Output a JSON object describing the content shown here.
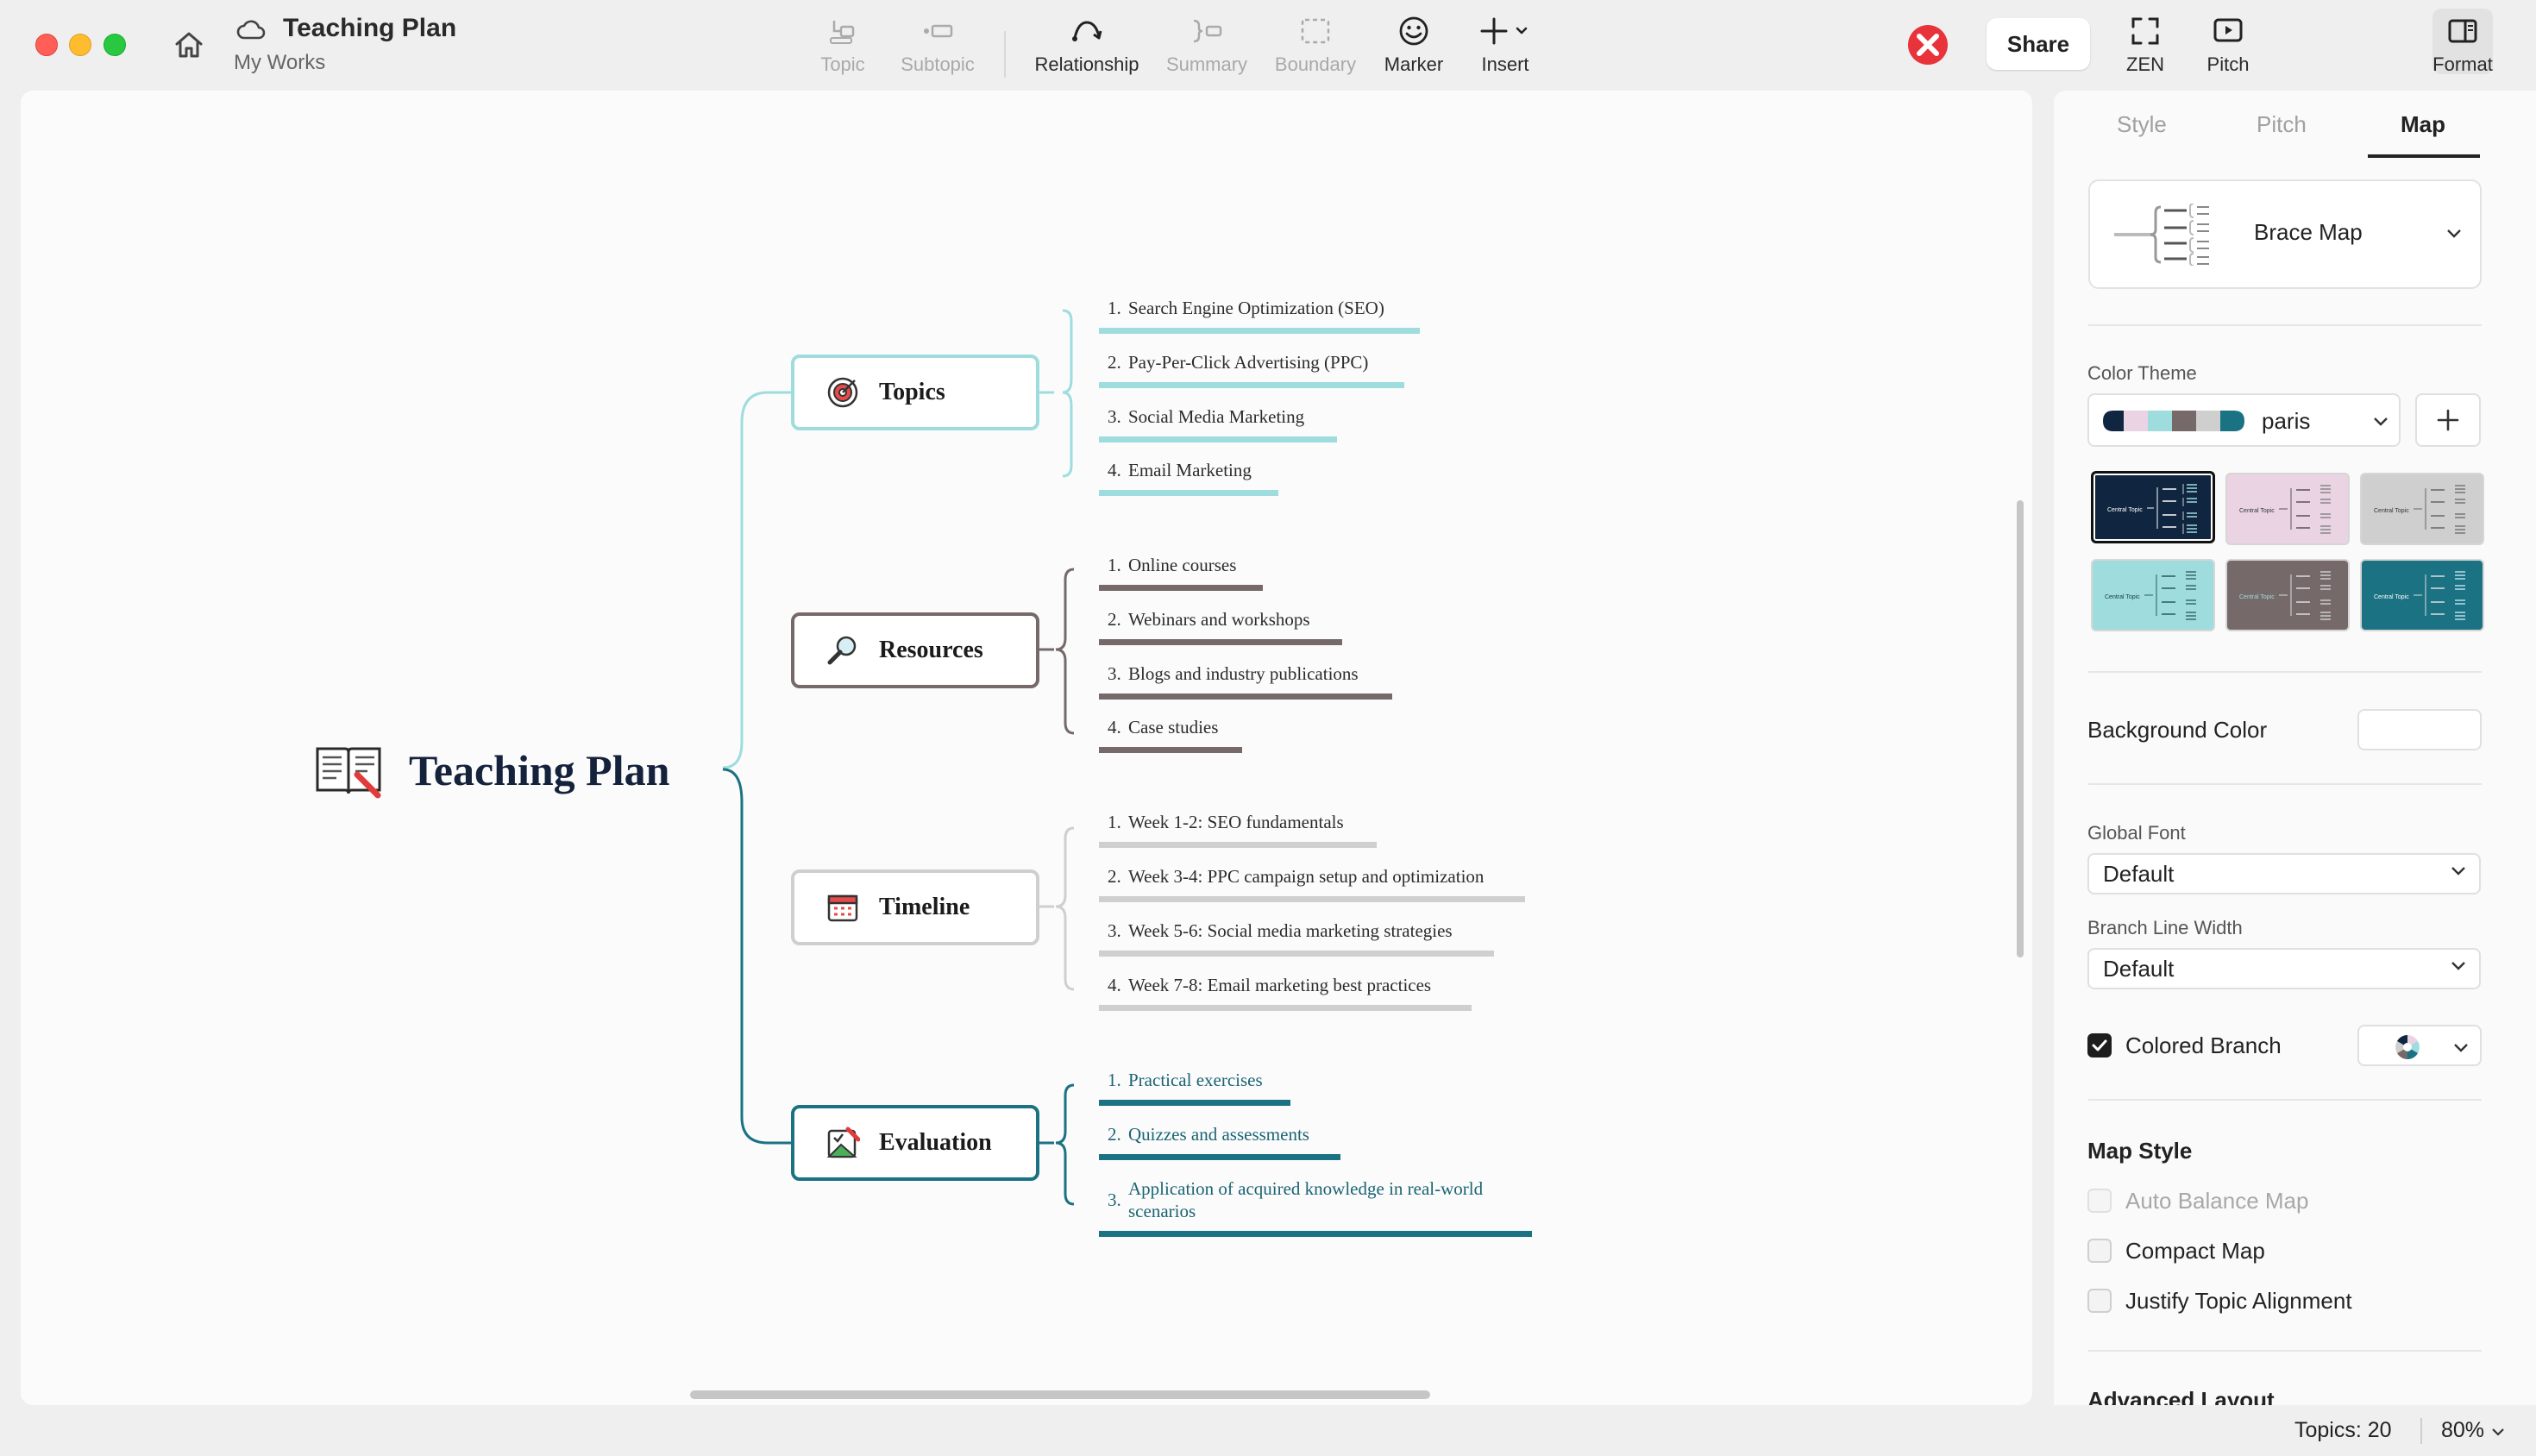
{
  "window": {
    "title": "Teaching Plan",
    "subtitle": "My Works"
  },
  "toolbar": {
    "topic": "Topic",
    "subtopic": "Subtopic",
    "relationship": "Relationship",
    "summary": "Summary",
    "boundary": "Boundary",
    "marker": "Marker",
    "insert": "Insert",
    "share": "Share",
    "zen": "ZEN",
    "pitch": "Pitch",
    "format": "Format"
  },
  "map": {
    "central": "Teaching Plan",
    "branches": [
      {
        "title": "Topics",
        "icon": "target-icon",
        "color": "#9fdcdd",
        "items": [
          "Search Engine Optimization (SEO)",
          "Pay-Per-Click Advertising (PPC)",
          "Social Media Marketing",
          "Email Marketing"
        ]
      },
      {
        "title": "Resources",
        "icon": "magnifier-icon",
        "color": "#756a69",
        "items": [
          "Online courses",
          "Webinars and workshops",
          "Blogs and industry publications",
          "Case studies"
        ]
      },
      {
        "title": "Timeline",
        "icon": "calendar-icon",
        "color": "#cfcfcf",
        "items": [
          "Week 1-2: SEO fundamentals",
          "Week 3-4: PPC campaign setup and optimization",
          "Week 5-6: Social media marketing strategies",
          "Week 7-8: Email marketing best practices"
        ]
      },
      {
        "title": "Evaluation",
        "icon": "checklist-icon",
        "color": "#1a7283",
        "items": [
          "Practical exercises",
          "Quizzes and assessments",
          "Application of acquired knowledge in real-world",
          "scenarios"
        ]
      }
    ],
    "numbers": [
      "1.",
      "2.",
      "3.",
      "4."
    ]
  },
  "panel": {
    "tabs": [
      "Style",
      "Pitch",
      "Map"
    ],
    "active_tab": "Map",
    "structure": "Brace Map",
    "color_theme_label": "Color Theme",
    "color_theme": "paris",
    "theme_swatches": [
      "#0f2540",
      "#ead3e3",
      "#756a69",
      "#cfcfcf",
      "#9fdcdd",
      "#1a7283"
    ],
    "thumb_text": "Central Topic",
    "background_color_label": "Background Color",
    "global_font_label": "Global Font",
    "global_font": "Default",
    "branch_line_width_label": "Branch Line Width",
    "branch_line_width": "Default",
    "colored_branch_label": "Colored Branch",
    "map_style_heading": "Map Style",
    "auto_balance": "Auto Balance Map",
    "compact_map": "Compact Map",
    "justify_alignment": "Justify Topic Alignment",
    "advanced_layout": "Advanced Layout"
  },
  "status": {
    "topics": "Topics: 20",
    "zoom": "80%"
  }
}
